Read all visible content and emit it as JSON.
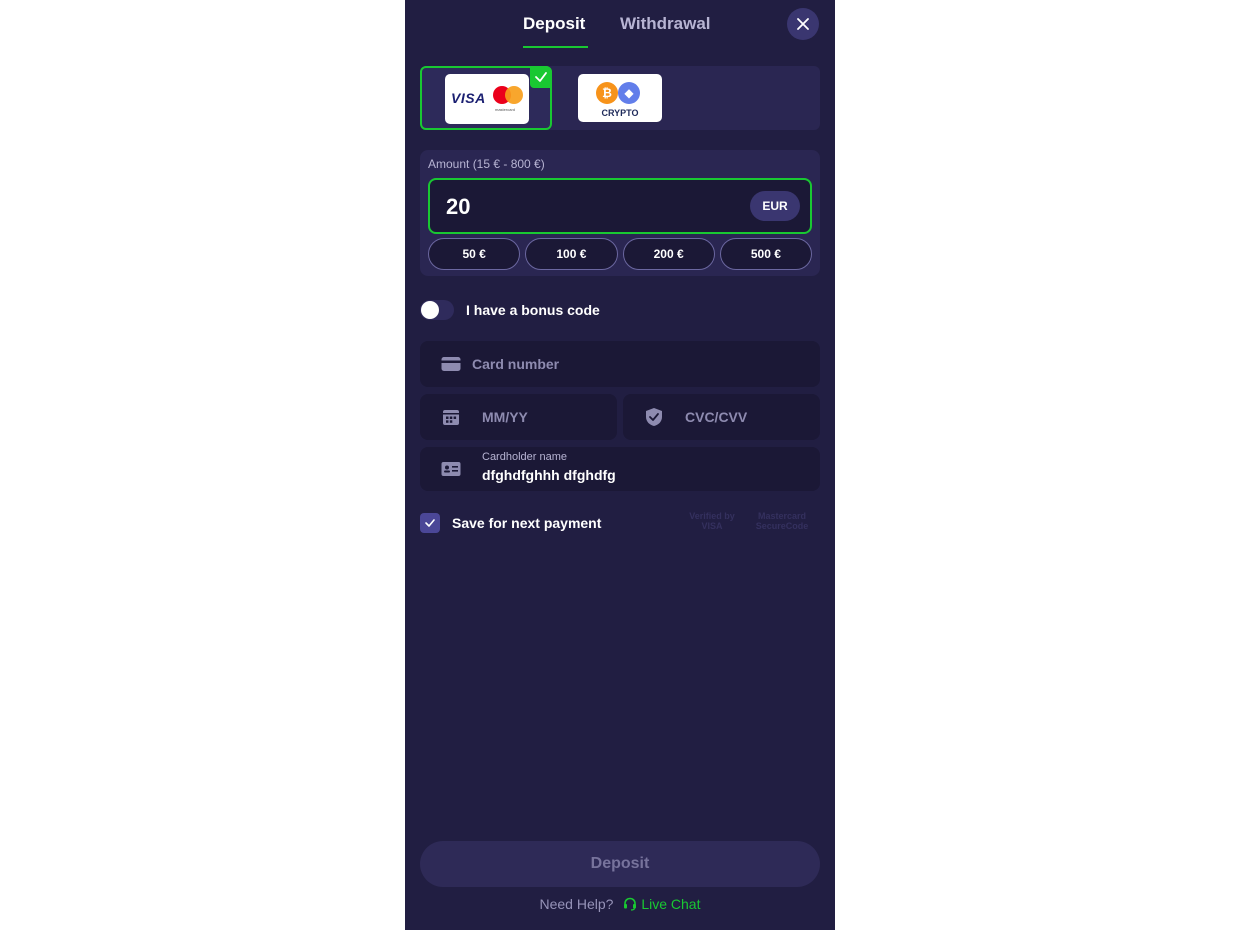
{
  "tabs": {
    "deposit": "Deposit",
    "withdrawal": "Withdrawal"
  },
  "methods": {
    "card": {
      "visa_text": "VISA",
      "mastercard_text": "mastercard"
    },
    "crypto": {
      "label": "CRYPTO",
      "btc_symbol": "₿",
      "eth_symbol": "◆"
    }
  },
  "amount": {
    "label": "Amount (15 € - 800 €)",
    "value": "20",
    "currency": "EUR",
    "presets": [
      "50 €",
      "100 €",
      "200 €",
      "500 €"
    ]
  },
  "bonus": {
    "label": "I have a bonus code",
    "enabled": false
  },
  "card_form": {
    "card_number_placeholder": "Card number",
    "expiry_placeholder": "MM/YY",
    "cvc_placeholder": "CVC/CVV",
    "holder_label": "Cardholder name",
    "holder_value": "dfghdfghhh dfghdfg"
  },
  "save": {
    "label": "Save for next payment",
    "checked": true
  },
  "badges": {
    "visa": "Verified by VISA",
    "mastercard": "Mastercard SecureCode"
  },
  "footer": {
    "deposit_button": "Deposit",
    "help_text": "Need Help?",
    "live_chat": "Live Chat"
  },
  "colors": {
    "accent": "#19c832",
    "panel": "#211e42",
    "field": "#1b1836"
  }
}
